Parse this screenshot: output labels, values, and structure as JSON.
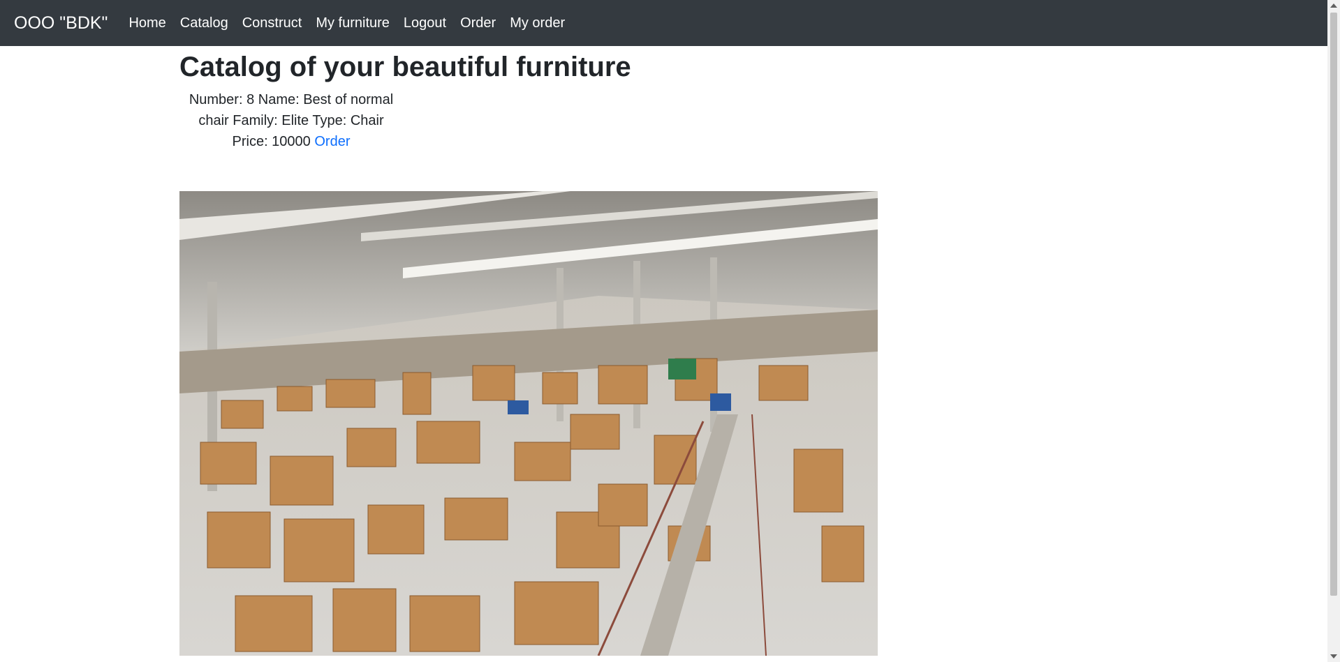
{
  "navbar": {
    "brand": "OOO \"BDK\"",
    "links": [
      "Home",
      "Catalog",
      "Construct",
      "My furniture",
      "Logout",
      "Order",
      "My order"
    ],
    "background": "#343a40"
  },
  "main": {
    "title": "Catalog of your beautiful furniture",
    "item": {
      "text": "Number: 8 Name: Best of normal chair Family: Elite Type: Chair Price: 10000",
      "order_label": "Order"
    }
  },
  "image": {
    "subject": "furniture factory warehouse floor with stacks of wooden panels"
  },
  "colors": {
    "link": "#0d6efd",
    "text": "#212529"
  }
}
